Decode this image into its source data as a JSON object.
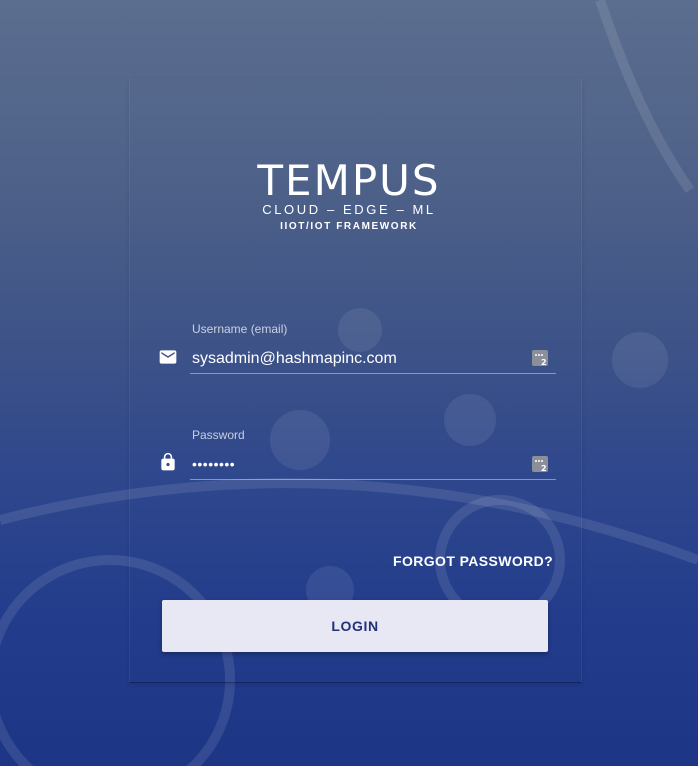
{
  "logo": {
    "title": "TEMPUS",
    "subtitle": "CLOUD – EDGE – ML",
    "tagline": "IIOT/IOT FRAMEWORK"
  },
  "username": {
    "label": "Username (email)",
    "value": "sysadmin@hashmapinc.com",
    "icon": "mail-icon"
  },
  "password": {
    "label": "Password",
    "value": "••••••••",
    "icon": "lock-icon"
  },
  "forgot_password": "FORGOT PASSWORD?",
  "login_button": "LOGIN",
  "colors": {
    "button_bg": "#e8e8f5",
    "button_text": "#23307a",
    "bg_top": "#5b6e8f",
    "bg_bottom": "#1d3585"
  }
}
